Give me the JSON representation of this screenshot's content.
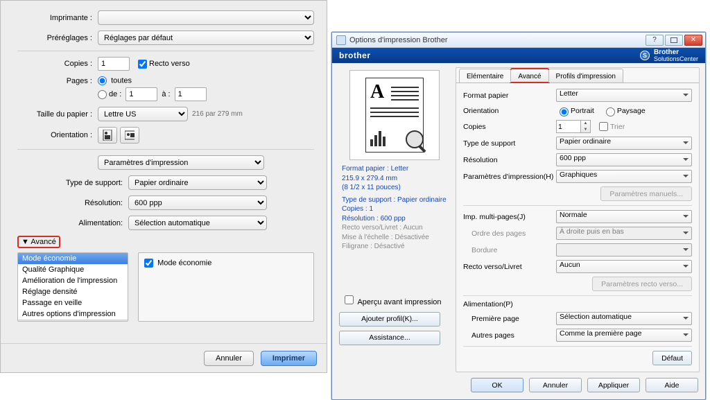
{
  "mac": {
    "labels": {
      "imprimante": "Imprimante :",
      "prereglages": "Préréglages :",
      "copies": "Copies :",
      "pages": "Pages :",
      "taille": "Taille du papier :",
      "orientation": "Orientation :",
      "type_support": "Type de support:",
      "resolution": "Résolution:",
      "alimentation": "Alimentation:",
      "avance": "Avancé"
    },
    "values": {
      "imprimante": "",
      "prereglages": "Réglages par défaut",
      "copies": "1",
      "recto_verso": "Recto verso",
      "pages_toutes": "toutes",
      "pages_de": "de :",
      "pages_a": "à :",
      "de_val": "1",
      "a_val": "1",
      "taille": "Lettre US",
      "taille_hint": "216 par 279 mm",
      "section": "Paramètres d'impression",
      "type_support": "Papier ordinaire",
      "resolution": "600 ppp",
      "alimentation": "Sélection automatique",
      "mode_eco_chk": "Mode économie"
    },
    "adv_list": [
      "Mode économie",
      "Qualité Graphique",
      "Amélioration de l'impression",
      "Réglage densité",
      "Passage en veille",
      "Autres options d'impression"
    ],
    "buttons": {
      "annuler": "Annuler",
      "imprimer": "Imprimer"
    }
  },
  "win": {
    "title": "Options d'impression Brother",
    "brand": "brother",
    "solutions_center_l1": "Brother",
    "solutions_center_l2": "SolutionsCenter",
    "tabs": {
      "elem": "Elémentaire",
      "avance": "Avancé",
      "profils": "Profils d'impression"
    },
    "preview": {
      "l1": "Format papier : Letter",
      "l2": "215.9 x 279.4 mm",
      "l3": "(8 1/2 x 11 pouces)",
      "l4": "Type de support : Papier ordinaire",
      "l5": "Copies : 1",
      "l6": "Résolution : 600 ppp",
      "l7": "Recto verso/Livret : Aucun",
      "l8": "Mise à l'échelle : Désactivée",
      "l9": "Filigrane : Désactivé"
    },
    "apercu": "Aperçu avant impression",
    "ajouter_profil": "Ajouter profil(K)...",
    "assistance": "Assistance...",
    "labels": {
      "format": "Format papier",
      "orientation": "Orientation",
      "portrait": "Portrait",
      "paysage": "Paysage",
      "copies": "Copies",
      "trier": "Trier",
      "type_support": "Type de support",
      "resolution": "Résolution",
      "param_impr": "Paramètres d'impression(H)",
      "param_manuels": "Paramètres manuels...",
      "multi": "Imp. multi-pages(J)",
      "ordre": "Ordre des pages",
      "bordure": "Bordure",
      "recto": "Recto verso/Livret",
      "param_recto": "Paramètres recto verso...",
      "alim": "Alimentation(P)",
      "premiere": "Première page",
      "autres": "Autres pages",
      "defaut": "Défaut"
    },
    "values": {
      "format": "Letter",
      "copies": "1",
      "type_support": "Papier ordinaire",
      "resolution": "600 ppp",
      "param_impr": "Graphiques",
      "multi": "Normale",
      "ordre": "À droite puis en bas",
      "bordure": "",
      "recto": "Aucun",
      "premiere": "Sélection automatique",
      "autres": "Comme la première page"
    },
    "footer": {
      "ok": "OK",
      "annuler": "Annuler",
      "appliquer": "Appliquer",
      "aide": "Aide"
    }
  }
}
